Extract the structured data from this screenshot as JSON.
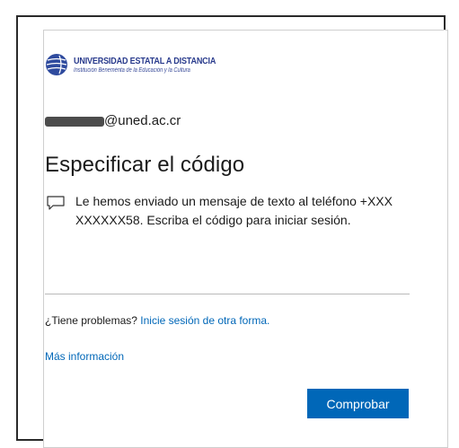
{
  "organization": {
    "name": "UNIVERSIDAD ESTATAL A DISTANCIA",
    "subtitle": "Institución Benemérita de la Educación y la Cultura"
  },
  "account": {
    "email_suffix": "@uned.ac.cr"
  },
  "page": {
    "title": "Especificar el código",
    "message": "Le hemos enviado un mensaje de texto al teléfono +XXX XXXXXX58. Escriba el código para iniciar sesión."
  },
  "trouble": {
    "question": "¿Tiene problemas?",
    "link_label": "Inicie sesión de otra forma."
  },
  "more_info_link": "Más información",
  "buttons": {
    "verify_label": "Comprobar"
  },
  "icons": {
    "logo": "uned-globe-logo",
    "message": "chat-bubble-icon"
  },
  "colors": {
    "accent": "#0067b8",
    "brand": "#283a8c"
  }
}
